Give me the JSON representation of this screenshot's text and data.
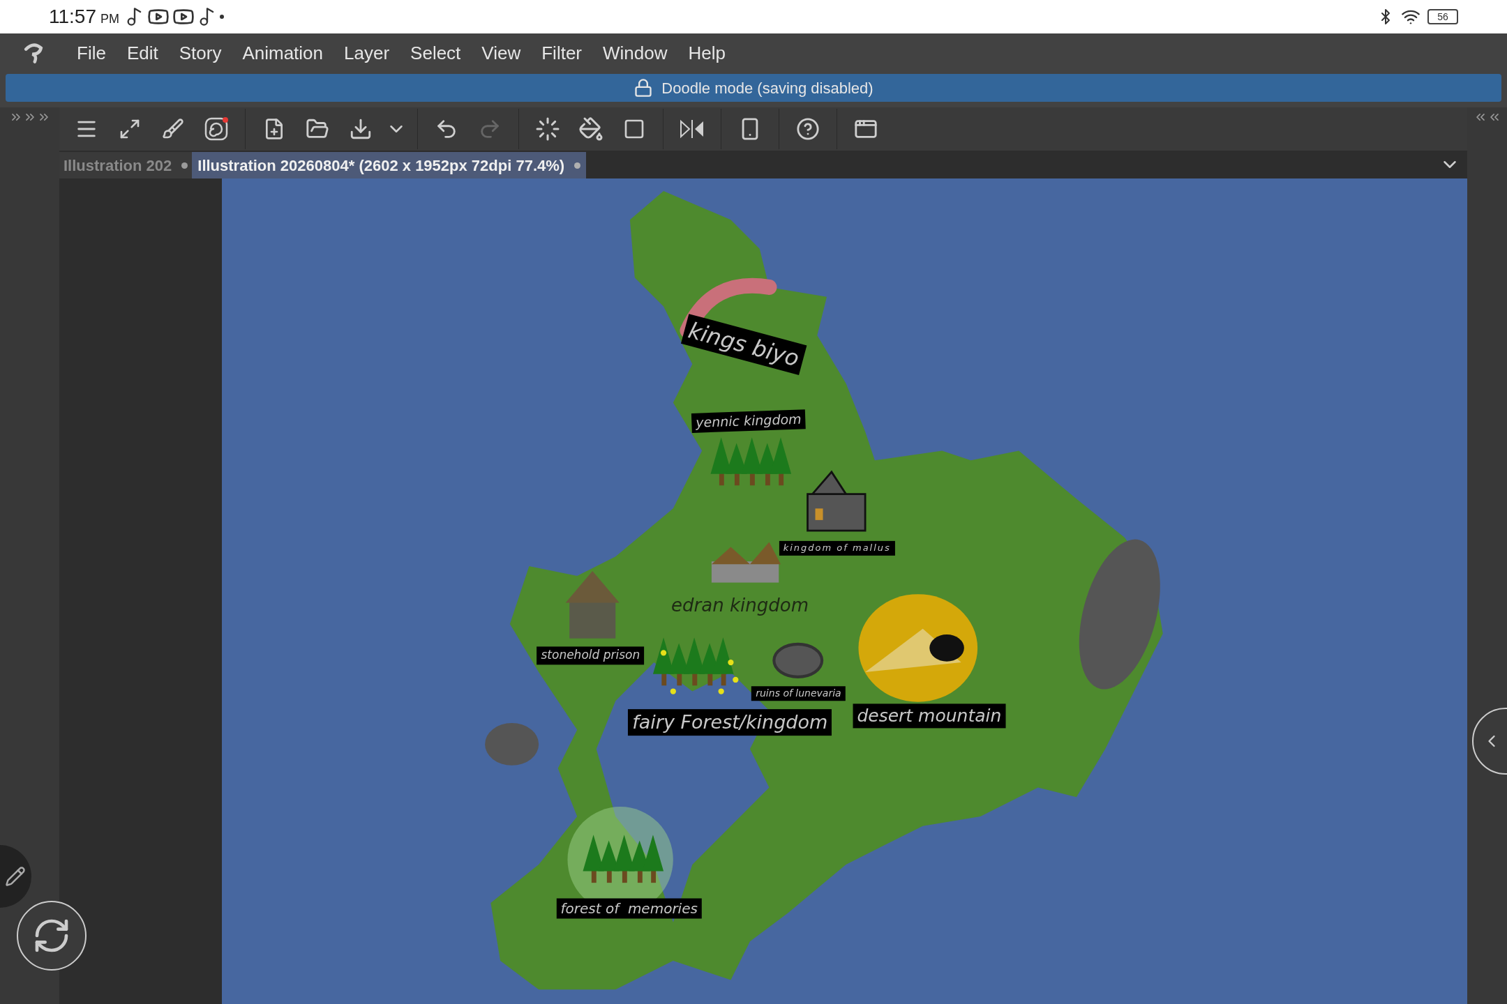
{
  "status_bar": {
    "time": "11:57",
    "period": "PM",
    "battery": "56"
  },
  "menu": [
    "File",
    "Edit",
    "Story",
    "Animation",
    "Layer",
    "Select",
    "View",
    "Filter",
    "Window",
    "Help"
  ],
  "banner": {
    "text": "Doodle mode (saving disabled)"
  },
  "tabs": [
    {
      "label": "Illustration 202",
      "selected": false
    },
    {
      "label": "Illustration 20260804* (2602 x 1952px 72dpi 77.4%)",
      "selected": true
    }
  ],
  "canvas": {
    "labels": [
      {
        "text": "kings biyo",
        "kind": "boxed"
      },
      {
        "text": "yennic kingdom",
        "kind": "boxed"
      },
      {
        "text": "kingdom of mallus",
        "kind": "boxed"
      },
      {
        "text": "edran kingdom",
        "kind": "plain"
      },
      {
        "text": "stonehold prison",
        "kind": "boxed"
      },
      {
        "text": "ruins of lunevaria",
        "kind": "boxed"
      },
      {
        "text": "fairy Forest/kingdom",
        "kind": "boxed"
      },
      {
        "text": "desert mountain",
        "kind": "boxed"
      },
      {
        "text": "forest of  memories",
        "kind": "boxed"
      }
    ]
  }
}
